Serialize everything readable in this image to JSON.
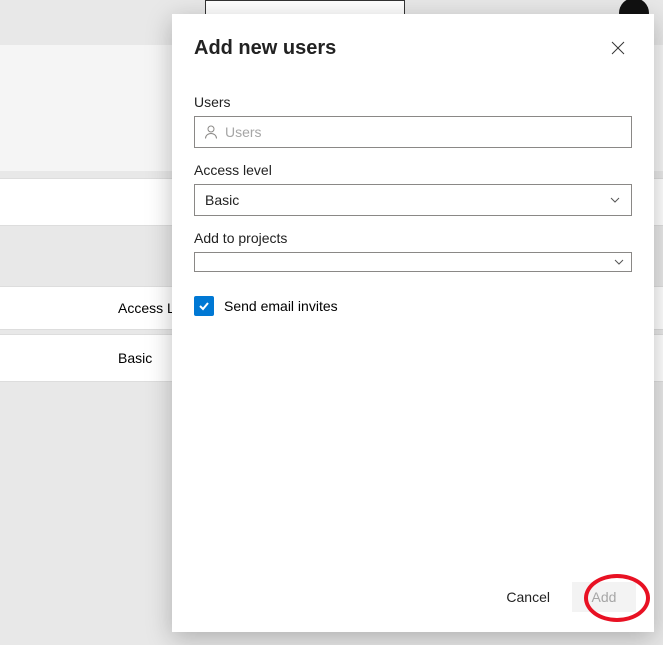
{
  "background": {
    "access_level_heading": "Access Lev",
    "row_value": "Basic"
  },
  "dialog": {
    "title": "Add new users",
    "users": {
      "label": "Users",
      "placeholder": "Users",
      "value": ""
    },
    "access_level": {
      "label": "Access level",
      "selected": "Basic"
    },
    "projects": {
      "label": "Add to projects",
      "selected": ""
    },
    "send_invites": {
      "label": "Send email invites",
      "checked": true
    },
    "buttons": {
      "cancel": "Cancel",
      "add": "Add"
    }
  }
}
